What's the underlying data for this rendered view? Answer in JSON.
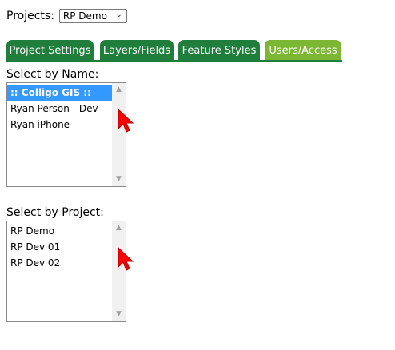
{
  "projects": {
    "label": "Projects:",
    "selected": "RP Demo"
  },
  "tabs": [
    {
      "label": "Project Settings"
    },
    {
      "label": "Layers/Fields"
    },
    {
      "label": "Feature Styles"
    },
    {
      "label": "Users/Access"
    }
  ],
  "select_by_name": {
    "label": "Select by Name:",
    "items": [
      ":: Colligo GIS ::",
      "Ryan Person - Dev",
      "Ryan iPhone"
    ]
  },
  "select_by_project": {
    "label": "Select by Project:",
    "items": [
      "RP Demo",
      "RP Dev 01",
      "RP Dev 02"
    ]
  },
  "colors": {
    "tab_active": "#7cb733",
    "tab_inactive": "#1f7e3b",
    "selection": "#3399ff",
    "cursor": "#ff0000"
  }
}
